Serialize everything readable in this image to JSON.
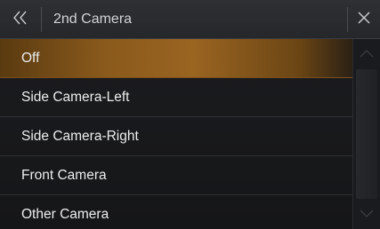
{
  "header": {
    "title": "2nd Camera",
    "back_icon": "double-chevron-left-icon",
    "close_icon": "close-icon"
  },
  "options": [
    {
      "label": "Off",
      "selected": true
    },
    {
      "label": "Side Camera-Left",
      "selected": false
    },
    {
      "label": "Side Camera-Right",
      "selected": false
    },
    {
      "label": "Front Camera",
      "selected": false
    },
    {
      "label": "Other Camera",
      "selected": false
    }
  ],
  "scrollbar": {
    "up_icon": "chevron-up-icon",
    "down_icon": "chevron-down-icon"
  },
  "colors": {
    "selected_highlight": "#9a6421",
    "background": "#18191c",
    "header": "#2b2d30",
    "text": "#eceded"
  }
}
